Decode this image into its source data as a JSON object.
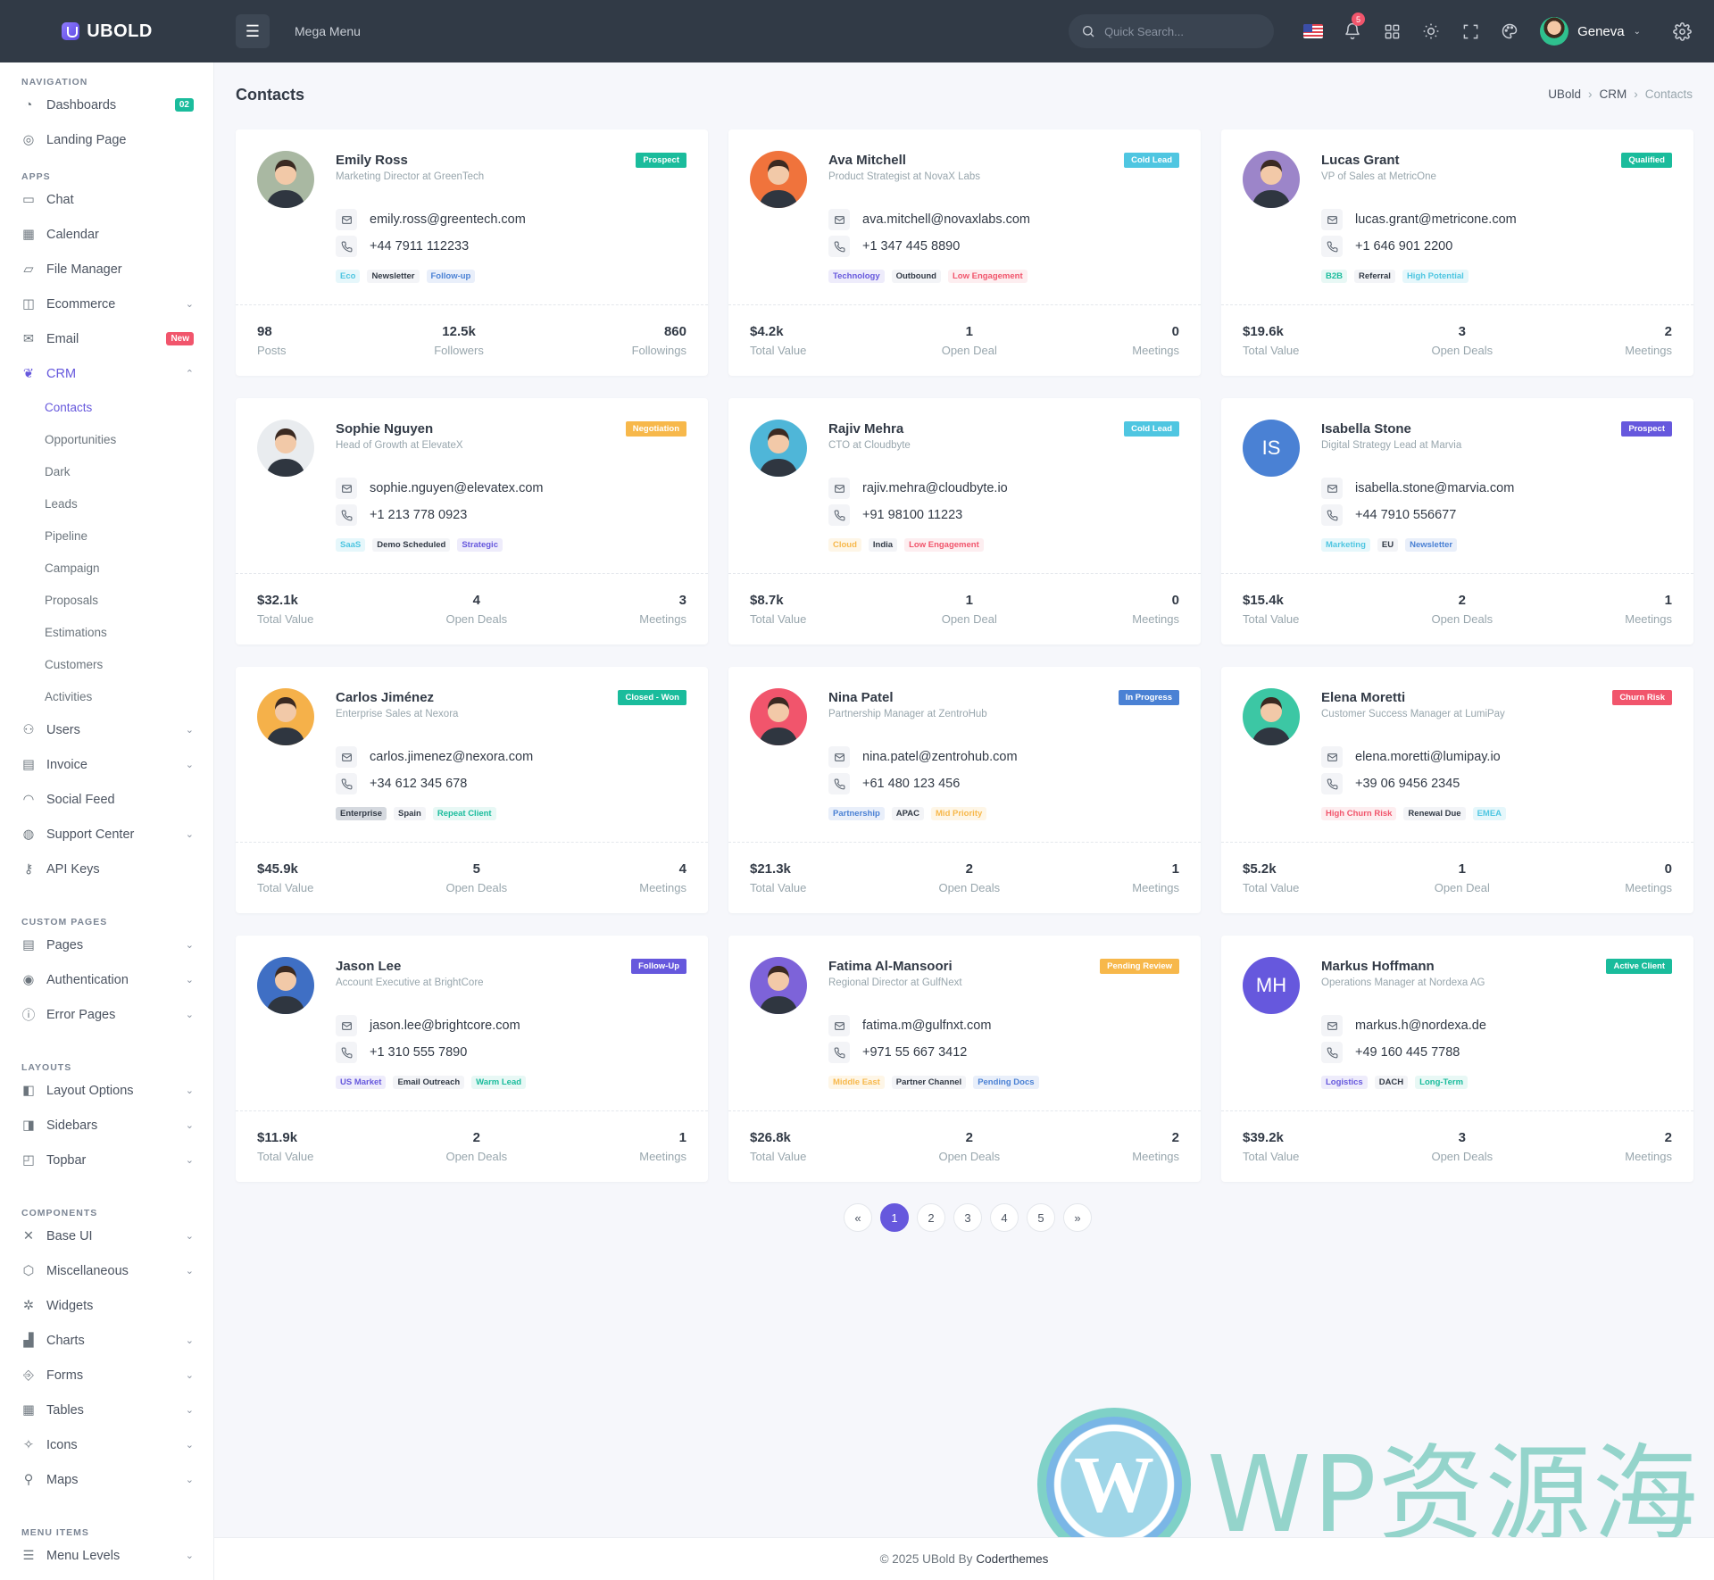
{
  "topbar": {
    "brand": "UBOLD",
    "mega_menu": "Mega Menu",
    "search_placeholder": "Quick Search...",
    "notification_count": "5",
    "user_name": "Geneva"
  },
  "sidebar": {
    "sections": {
      "navigation": "NAVIGATION",
      "apps": "APPS",
      "custom_pages": "CUSTOM PAGES",
      "layouts": "LAYOUTS",
      "components": "COMPONENTS",
      "menu_items": "MENU ITEMS"
    },
    "items": {
      "dashboards": "Dashboards",
      "dashboards_badge": "02",
      "landing": "Landing Page",
      "chat": "Chat",
      "calendar": "Calendar",
      "file_manager": "File Manager",
      "ecommerce": "Ecommerce",
      "email": "Email",
      "email_badge": "New",
      "crm": "CRM",
      "users": "Users",
      "invoice": "Invoice",
      "social_feed": "Social Feed",
      "support_center": "Support Center",
      "api_keys": "API Keys",
      "pages": "Pages",
      "authentication": "Authentication",
      "error_pages": "Error Pages",
      "layout_options": "Layout Options",
      "sidebars": "Sidebars",
      "topbar": "Topbar",
      "base_ui": "Base UI",
      "miscellaneous": "Miscellaneous",
      "widgets": "Widgets",
      "charts": "Charts",
      "forms": "Forms",
      "tables": "Tables",
      "icons": "Icons",
      "maps": "Maps",
      "menu_levels": "Menu Levels"
    },
    "crm_sub": [
      "Contacts",
      "Opportunities",
      "Dark",
      "Leads",
      "Pipeline",
      "Campaign",
      "Proposals",
      "Estimations",
      "Customers",
      "Activities"
    ]
  },
  "page": {
    "title": "Contacts",
    "breadcrumb": [
      "UBold",
      "CRM",
      "Contacts"
    ]
  },
  "contacts": [
    {
      "name": "Emily Ross",
      "role": "Marketing Director at GreenTech",
      "status": "Prospect",
      "status_color": "#1abc9c",
      "email": "emily.ross@greentech.com",
      "phone": "+44 7911 112233",
      "tags": [
        {
          "t": "Eco",
          "c": "#4fc6e1",
          "bg": "#e6f7fb"
        },
        {
          "t": "Newsletter",
          "c": "#323a46",
          "bg": "#f3f4f7"
        },
        {
          "t": "Follow-up",
          "c": "#4a81d4",
          "bg": "#e9effa"
        }
      ],
      "stats": [
        {
          "v": "98",
          "l": "Posts"
        },
        {
          "v": "12.5k",
          "l": "Followers"
        },
        {
          "v": "860",
          "l": "Followings"
        }
      ],
      "avatar_bg": "#a9b8a2",
      "initials": ""
    },
    {
      "name": "Ava Mitchell",
      "role": "Product Strategist at NovaX Labs",
      "status": "Cold Lead",
      "status_color": "#4fc6e1",
      "email": "ava.mitchell@novaxlabs.com",
      "phone": "+1 347 445 8890",
      "tags": [
        {
          "t": "Technology",
          "c": "#6658dd",
          "bg": "#eeecfb"
        },
        {
          "t": "Outbound",
          "c": "#323a46",
          "bg": "#f3f4f7"
        },
        {
          "t": "Low Engagement",
          "c": "#f1556c",
          "bg": "#fdeef0"
        }
      ],
      "stats": [
        {
          "v": "$4.2k",
          "l": "Total Value"
        },
        {
          "v": "1",
          "l": "Open Deal"
        },
        {
          "v": "0",
          "l": "Meetings"
        }
      ],
      "avatar_bg": "#f0733c",
      "initials": ""
    },
    {
      "name": "Lucas Grant",
      "role": "VP of Sales at MetricOne",
      "status": "Qualified",
      "status_color": "#1abc9c",
      "email": "lucas.grant@metricone.com",
      "phone": "+1 646 901 2200",
      "tags": [
        {
          "t": "B2B",
          "c": "#1abc9c",
          "bg": "#e8f8f5"
        },
        {
          "t": "Referral",
          "c": "#323a46",
          "bg": "#f3f4f7"
        },
        {
          "t": "High Potential",
          "c": "#4fc6e1",
          "bg": "#e6f7fb"
        }
      ],
      "stats": [
        {
          "v": "$19.6k",
          "l": "Total Value"
        },
        {
          "v": "3",
          "l": "Open Deals"
        },
        {
          "v": "2",
          "l": "Meetings"
        }
      ],
      "avatar_bg": "#9c85c9",
      "initials": ""
    },
    {
      "name": "Sophie Nguyen",
      "role": "Head of Growth at ElevateX",
      "status": "Negotiation",
      "status_color": "#f7b84b",
      "email": "sophie.nguyen@elevatex.com",
      "phone": "+1 213 778 0923",
      "tags": [
        {
          "t": "SaaS",
          "c": "#4fc6e1",
          "bg": "#e6f7fb"
        },
        {
          "t": "Demo Scheduled",
          "c": "#323a46",
          "bg": "#f3f4f7"
        },
        {
          "t": "Strategic",
          "c": "#6658dd",
          "bg": "#eeecfb"
        }
      ],
      "stats": [
        {
          "v": "$32.1k",
          "l": "Total Value"
        },
        {
          "v": "4",
          "l": "Open Deals"
        },
        {
          "v": "3",
          "l": "Meetings"
        }
      ],
      "avatar_bg": "#e9ecef",
      "initials": ""
    },
    {
      "name": "Rajiv Mehra",
      "role": "CTO at Cloudbyte",
      "status": "Cold Lead",
      "status_color": "#4fc6e1",
      "email": "rajiv.mehra@cloudbyte.io",
      "phone": "+91 98100 11223",
      "tags": [
        {
          "t": "Cloud",
          "c": "#f7b84b",
          "bg": "#fef6e7"
        },
        {
          "t": "India",
          "c": "#323a46",
          "bg": "#f3f4f7"
        },
        {
          "t": "Low Engagement",
          "c": "#f1556c",
          "bg": "#fdeef0"
        }
      ],
      "stats": [
        {
          "v": "$8.7k",
          "l": "Total Value"
        },
        {
          "v": "1",
          "l": "Open Deal"
        },
        {
          "v": "0",
          "l": "Meetings"
        }
      ],
      "avatar_bg": "#4fb6d8",
      "initials": ""
    },
    {
      "name": "Isabella Stone",
      "role": "Digital Strategy Lead at Marvia",
      "status": "Prospect",
      "status_color": "#6658dd",
      "email": "isabella.stone@marvia.com",
      "phone": "+44 7910 556677",
      "tags": [
        {
          "t": "Marketing",
          "c": "#4fc6e1",
          "bg": "#e6f7fb"
        },
        {
          "t": "EU",
          "c": "#323a46",
          "bg": "#f3f4f7"
        },
        {
          "t": "Newsletter",
          "c": "#4a81d4",
          "bg": "#e9effa"
        }
      ],
      "stats": [
        {
          "v": "$15.4k",
          "l": "Total Value"
        },
        {
          "v": "2",
          "l": "Open Deals"
        },
        {
          "v": "1",
          "l": "Meetings"
        }
      ],
      "avatar_bg": "#4a81d4",
      "initials": "IS"
    },
    {
      "name": "Carlos Jiménez",
      "role": "Enterprise Sales at Nexora",
      "status": "Closed - Won",
      "status_color": "#1abc9c",
      "email": "carlos.jimenez@nexora.com",
      "phone": "+34 612 345 678",
      "tags": [
        {
          "t": "Enterprise",
          "c": "#323a46",
          "bg": "#d5d9df"
        },
        {
          "t": "Spain",
          "c": "#323a46",
          "bg": "#f3f4f7"
        },
        {
          "t": "Repeat Client",
          "c": "#1abc9c",
          "bg": "#e8f8f5"
        }
      ],
      "stats": [
        {
          "v": "$45.9k",
          "l": "Total Value"
        },
        {
          "v": "5",
          "l": "Open Deals"
        },
        {
          "v": "4",
          "l": "Meetings"
        }
      ],
      "avatar_bg": "#f5b14a",
      "initials": ""
    },
    {
      "name": "Nina Patel",
      "role": "Partnership Manager at ZentroHub",
      "status": "In Progress",
      "status_color": "#4a81d4",
      "email": "nina.patel@zentrohub.com",
      "phone": "+61 480 123 456",
      "tags": [
        {
          "t": "Partnership",
          "c": "#4a81d4",
          "bg": "#e9effa"
        },
        {
          "t": "APAC",
          "c": "#323a46",
          "bg": "#f3f4f7"
        },
        {
          "t": "Mid Priority",
          "c": "#f7b84b",
          "bg": "#fef6e7"
        }
      ],
      "stats": [
        {
          "v": "$21.3k",
          "l": "Total Value"
        },
        {
          "v": "2",
          "l": "Open Deals"
        },
        {
          "v": "1",
          "l": "Meetings"
        }
      ],
      "avatar_bg": "#f1556c",
      "initials": ""
    },
    {
      "name": "Elena Moretti",
      "role": "Customer Success Manager at LumiPay",
      "status": "Churn Risk",
      "status_color": "#f1556c",
      "email": "elena.moretti@lumipay.io",
      "phone": "+39 06 9456 2345",
      "tags": [
        {
          "t": "High Churn Risk",
          "c": "#f1556c",
          "bg": "#fdeef0"
        },
        {
          "t": "Renewal Due",
          "c": "#323a46",
          "bg": "#f3f4f7"
        },
        {
          "t": "EMEA",
          "c": "#4fc6e1",
          "bg": "#e6f7fb"
        }
      ],
      "stats": [
        {
          "v": "$5.2k",
          "l": "Total Value"
        },
        {
          "v": "1",
          "l": "Open Deal"
        },
        {
          "v": "0",
          "l": "Meetings"
        }
      ],
      "avatar_bg": "#3cc7a4",
      "initials": ""
    },
    {
      "name": "Jason Lee",
      "role": "Account Executive at BrightCore",
      "status": "Follow-Up",
      "status_color": "#6658dd",
      "email": "jason.lee@brightcore.com",
      "phone": "+1 310 555 7890",
      "tags": [
        {
          "t": "US Market",
          "c": "#6658dd",
          "bg": "#eeecfb"
        },
        {
          "t": "Email Outreach",
          "c": "#323a46",
          "bg": "#f3f4f7"
        },
        {
          "t": "Warm Lead",
          "c": "#1abc9c",
          "bg": "#e8f8f5"
        }
      ],
      "stats": [
        {
          "v": "$11.9k",
          "l": "Total Value"
        },
        {
          "v": "2",
          "l": "Open Deals"
        },
        {
          "v": "1",
          "l": "Meetings"
        }
      ],
      "avatar_bg": "#3f6fc4",
      "initials": ""
    },
    {
      "name": "Fatima Al-Mansoori",
      "role": "Regional Director at GulfNext",
      "status": "Pending Review",
      "status_color": "#f7b84b",
      "email": "fatima.m@gulfnxt.com",
      "phone": "+971 55 667 3412",
      "tags": [
        {
          "t": "Middle East",
          "c": "#f7b84b",
          "bg": "#fef6e7"
        },
        {
          "t": "Partner Channel",
          "c": "#323a46",
          "bg": "#f3f4f7"
        },
        {
          "t": "Pending Docs",
          "c": "#4a81d4",
          "bg": "#e9effa"
        }
      ],
      "stats": [
        {
          "v": "$26.8k",
          "l": "Total Value"
        },
        {
          "v": "2",
          "l": "Open Deals"
        },
        {
          "v": "2",
          "l": "Meetings"
        }
      ],
      "avatar_bg": "#7d63d9",
      "initials": ""
    },
    {
      "name": "Markus Hoffmann",
      "role": "Operations Manager at Nordexa AG",
      "status": "Active Client",
      "status_color": "#1abc9c",
      "email": "markus.h@nordexa.de",
      "phone": "+49 160 445 7788",
      "tags": [
        {
          "t": "Logistics",
          "c": "#6658dd",
          "bg": "#eeecfb"
        },
        {
          "t": "DACH",
          "c": "#323a46",
          "bg": "#f3f4f7"
        },
        {
          "t": "Long-Term",
          "c": "#1abc9c",
          "bg": "#e8f8f5"
        }
      ],
      "stats": [
        {
          "v": "$39.2k",
          "l": "Total Value"
        },
        {
          "v": "3",
          "l": "Open Deals"
        },
        {
          "v": "2",
          "l": "Meetings"
        }
      ],
      "avatar_bg": "#6658dd",
      "initials": "MH"
    }
  ],
  "pagination": [
    "«",
    "1",
    "2",
    "3",
    "4",
    "5",
    "»"
  ],
  "pagination_active": "1",
  "watermark": {
    "text": "WP资源海"
  },
  "footer": {
    "prefix": "© 2025 UBold By",
    "author": "Coderthemes"
  }
}
